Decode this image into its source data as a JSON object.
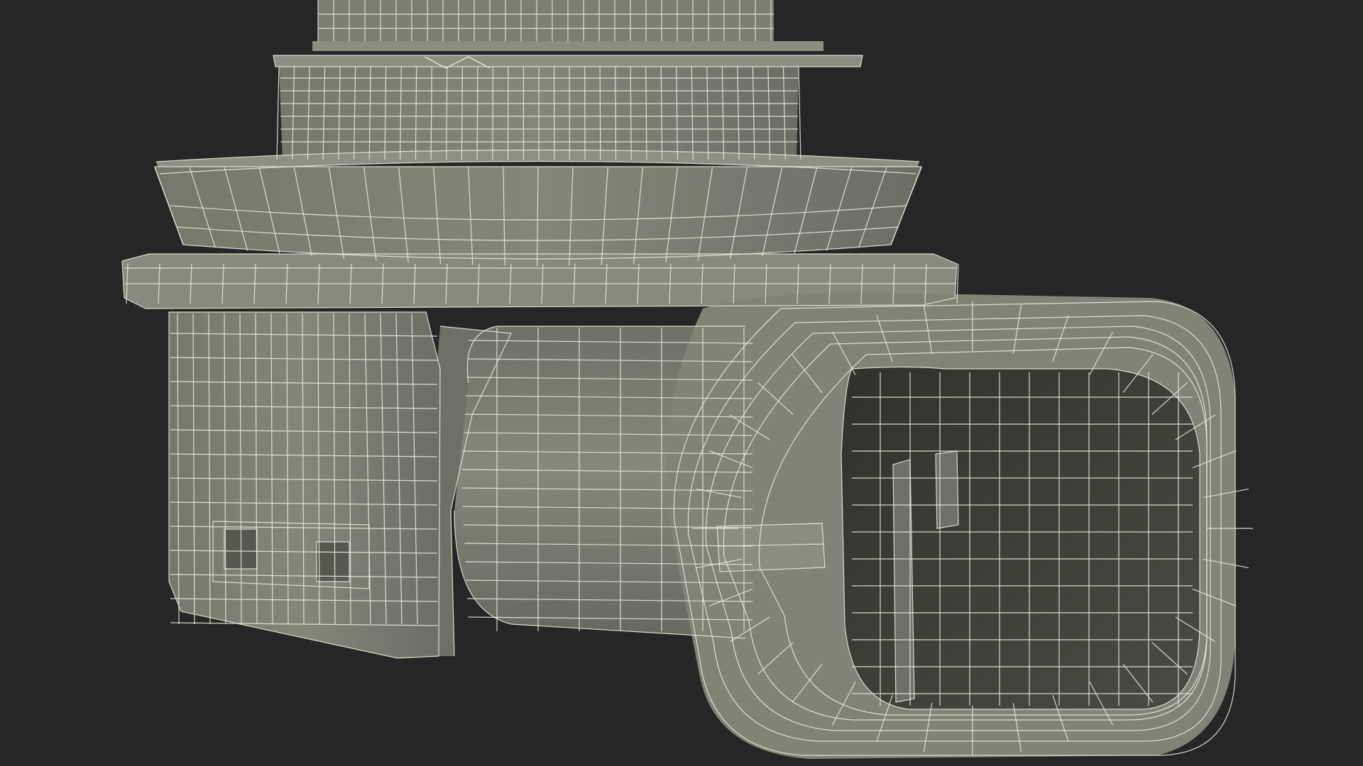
{
  "render": {
    "background": "#262626",
    "surface_color": "#7f8174",
    "surface_light": "#8d8f82",
    "surface_dark": "#5f6157",
    "cavity_color": "#3a3c35",
    "wire_color": "#e8e8dc"
  }
}
